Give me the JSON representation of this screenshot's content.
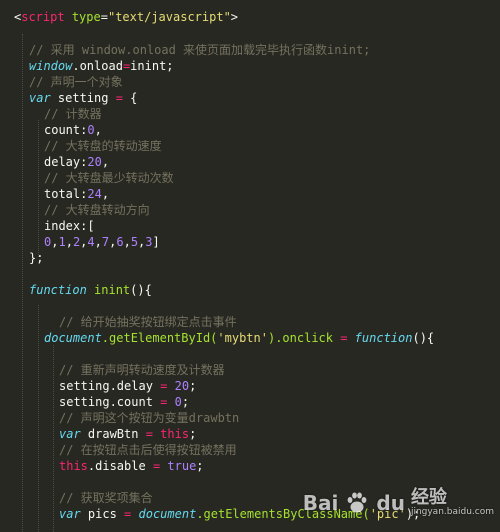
{
  "editor": {
    "theme_colors": {
      "background": "#272822",
      "comment": "#75715e",
      "keyword": "#66d9ef",
      "string": "#e6db74",
      "number": "#ae81ff",
      "tag": "#f92672",
      "function": "#a6e22e"
    },
    "code": {
      "l1": {
        "open": "<",
        "tag": "script",
        "attr": "type",
        "eq": "=",
        "val": "\"text/javascript\"",
        "close": ">"
      },
      "l2": {
        "comment": "// 采用 window.onload 来使页面加载完毕执行函数inint;"
      },
      "l3": {
        "obj": "window",
        "prop": ".onload",
        "op": "=",
        "rest": "inint;"
      },
      "l4": {
        "comment": "// 声明一个对象"
      },
      "l5": {
        "kw": "var",
        "name": " setting ",
        "op": "=",
        "rest": " {"
      },
      "l6": {
        "comment": "// 计数器"
      },
      "l7": {
        "key": "count:",
        "num": "0",
        "rest": ","
      },
      "l8": {
        "comment": "// 大转盘的转动速度"
      },
      "l9": {
        "key": "delay:",
        "num": "20",
        "rest": ","
      },
      "l10": {
        "comment": "// 大转盘最少转动次数"
      },
      "l11": {
        "key": "total:",
        "num": "24",
        "rest": ","
      },
      "l12": {
        "comment": "// 大转盘转动方向"
      },
      "l13": {
        "key": "index:["
      },
      "l14": {
        "values": [
          "0",
          "1",
          "2",
          "4",
          "7",
          "6",
          "5",
          "3"
        ],
        "close": "]"
      },
      "l15": {
        "text": "};"
      },
      "l16": {
        "kw": "function",
        "name": " inint",
        "rest": "(){"
      },
      "l17": {
        "comment": "// 给开始抽奖按钮绑定点击事件"
      },
      "l18": {
        "obj": "document",
        "call": ".getElementById(",
        "str": "'mybtn'",
        "mid": ").onclick ",
        "op": "=",
        "kw": " function",
        "rest": "(){"
      },
      "l19": {
        "comment": "// 重新声明转动速度及计数器"
      },
      "l20": {
        "lhs": "setting.delay ",
        "op": "=",
        "num": " 20",
        "rest": ";"
      },
      "l21": {
        "lhs": "setting.count ",
        "op": "=",
        "num": " 0",
        "rest": ";"
      },
      "l22": {
        "comment": "// 声明这个按钮为变量drawbtn"
      },
      "l23": {
        "kw": "var",
        "name": " drawBtn ",
        "op": "=",
        "this": " this",
        "rest": ";"
      },
      "l24": {
        "comment": "// 在按钮点击后使得按钮被禁用"
      },
      "l25": {
        "this": "this",
        "prop": ".disable ",
        "op": "=",
        "val": " true",
        "rest": ";"
      },
      "l26": {
        "comment": "// 获取奖项集合"
      },
      "l27": {
        "kw": "var",
        "name": " pics ",
        "op": "=",
        "obj": " document",
        "call": ".getElementsByClassName(",
        "str": "'pic'",
        "rest": ");"
      }
    }
  },
  "watermark": {
    "logo": "Bai",
    "logo2": "du",
    "main": "经验",
    "sub": "jingyan.baidu.com"
  }
}
